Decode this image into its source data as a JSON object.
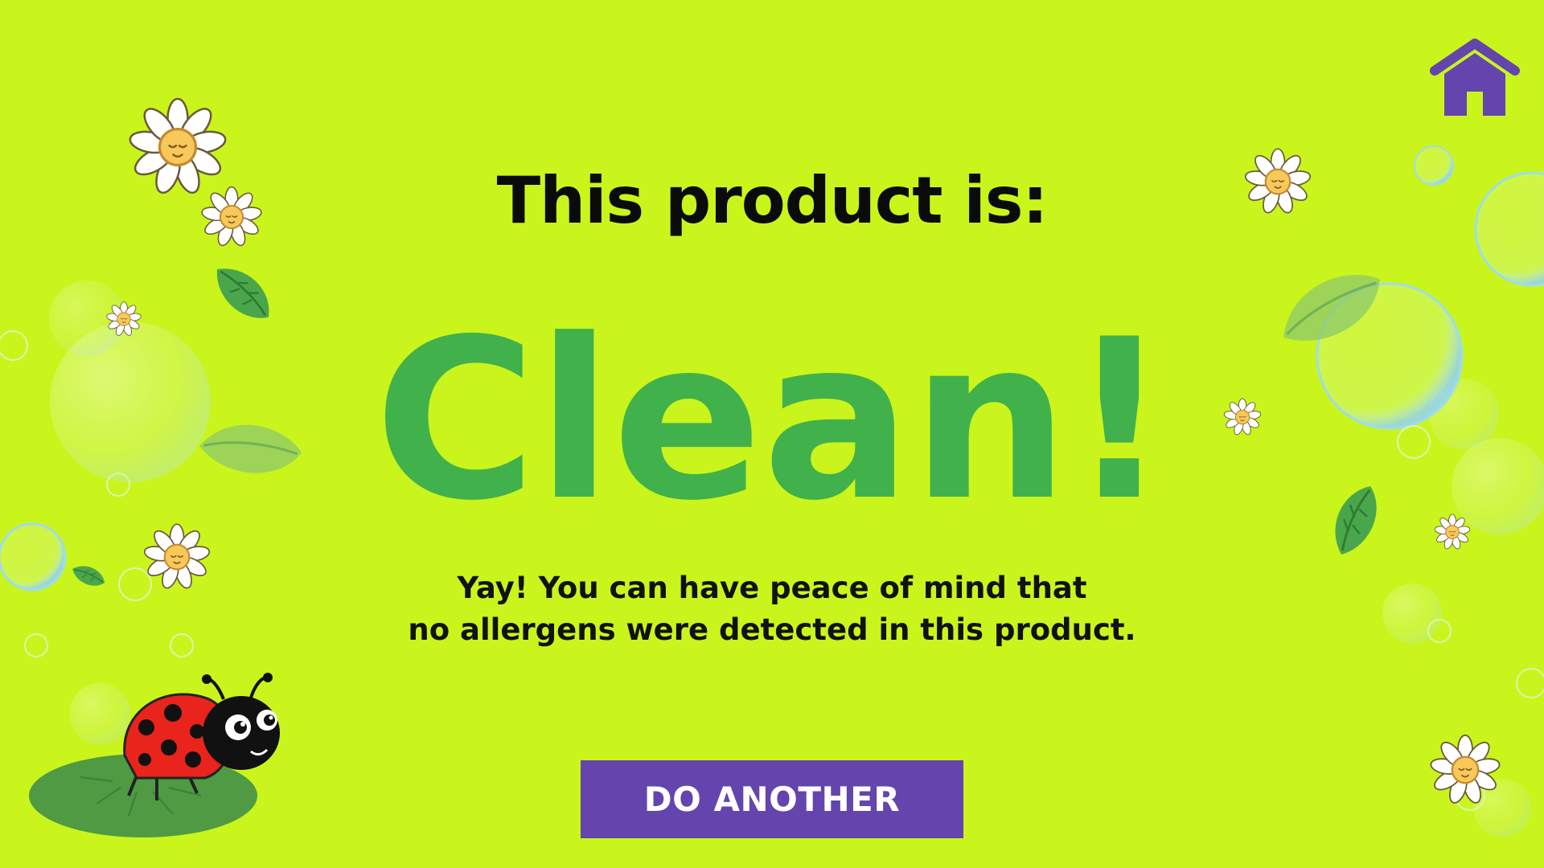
{
  "screen": {
    "background_color": "#c9f51c",
    "title": "This product is:",
    "result_word": "Clean!",
    "result_color": "#41b14b",
    "message_line1": "Yay! You can have peace of mind that",
    "message_line2": "no allergens were detected in this product."
  },
  "actions": {
    "do_another_label": "DO ANOTHER",
    "do_another_color": "#6444ad",
    "home_icon": "home-icon",
    "home_color": "#6444ad"
  },
  "decorations": {
    "icons": [
      "daisy-icon",
      "leaf-icon",
      "bubble-icon",
      "ladybug-icon",
      "lily-pad-icon"
    ]
  }
}
